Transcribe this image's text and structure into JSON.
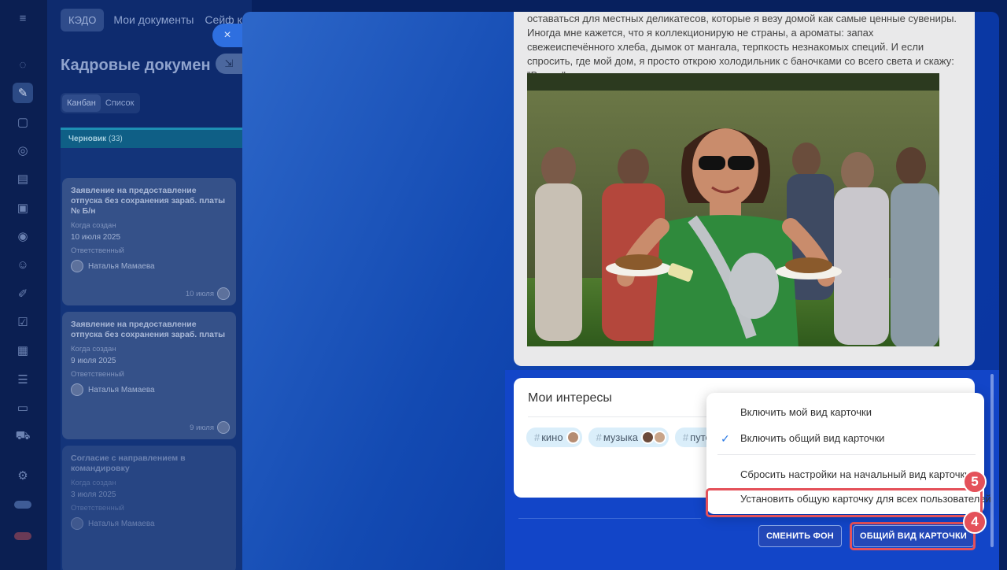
{
  "app": {
    "tabs": [
      "КЭДО",
      "Мои документы",
      "Сейф ко"
    ],
    "page_title": "Кадровые докумен",
    "view_switch": [
      "Канбан",
      "Список"
    ],
    "column": {
      "name": "Черновик",
      "count": "(33)"
    },
    "cards": [
      {
        "title": "Заявление на предоставление отпуска без сохранения зараб. платы № Б/н",
        "created_label": "Когда создан",
        "created": "10 июля 2025",
        "resp_label": "Ответственный",
        "responsible": "Наталья Мамаева",
        "date_short": "10 июля"
      },
      {
        "title": "Заявление на предоставление отпуска без сохранения зараб. платы",
        "created_label": "Когда создан",
        "created": "9 июля 2025",
        "resp_label": "Ответственный",
        "responsible": "Наталья Мамаева",
        "date_short": "9 июля"
      },
      {
        "title": "Согласие с направлением в командировку",
        "created_label": "Когда создан",
        "created": "3 июля 2025",
        "resp_label": "Ответственный",
        "responsible": "Наталья Мамаева",
        "date_short": ""
      }
    ]
  },
  "slider": {
    "close_icon": "×",
    "collapse_icon": "⇲",
    "post_text": "оставаться для местных деликатесов, которые я везу домой как самые ценные сувениры. Иногда мне кажется, что я коллекционирую не страны, а ароматы: запах свежеиспечённого хлеба, дымок от мангала, терпкость незнакомых специй. И если спросить, где мой дом, я просто открою холодильник с баночками со всего света и скажу: \"Вот он\".",
    "interests_title": "Мои интересы",
    "interest_tags": [
      "кино",
      "музыка",
      "путеш"
    ],
    "buttons": {
      "change_bg": "СМЕНИТЬ ФОН",
      "common_view": "ОБЩИЙ ВИД КАРТОЧКИ"
    }
  },
  "menu": {
    "items": [
      "Включить мой вид карточки",
      "Включить общий вид карточки",
      "Сбросить настройки на начальный вид карточки",
      "Установить общую карточку для всех пользователей"
    ],
    "checked_index": 1
  },
  "badges": {
    "step_4": "4",
    "step_5": "5"
  },
  "colors": {
    "highlight": "#e4515a",
    "accent": "#2348b8",
    "check": "#2d7be5"
  }
}
